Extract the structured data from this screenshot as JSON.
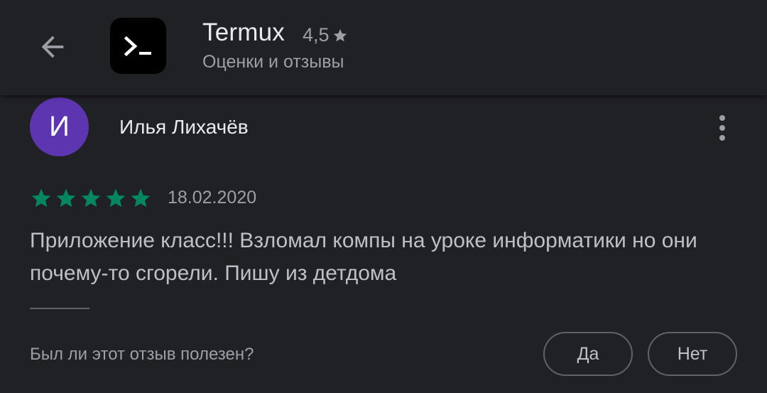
{
  "header": {
    "back_icon": "arrow-back-icon",
    "app_icon": "terminal-prompt-icon",
    "app_name": "Termux",
    "rating": "4,5",
    "rating_icon": "star-icon",
    "subtitle": "Оценки и отзывы"
  },
  "review": {
    "avatar_letter": "И",
    "avatar_color": "#5e35b1",
    "author": "Илья Лихачёв",
    "more_icon": "more-vertical-icon",
    "stars": 5,
    "star_color": "#01875f",
    "date": "18.02.2020",
    "text": "Приложение класс!!! Взломал компы на уроке информатики но они почему-то сгорели. Пишу из детдома"
  },
  "feedback": {
    "question": "Был ли этот отзыв полезен?",
    "yes_label": "Да",
    "no_label": "Нет"
  }
}
